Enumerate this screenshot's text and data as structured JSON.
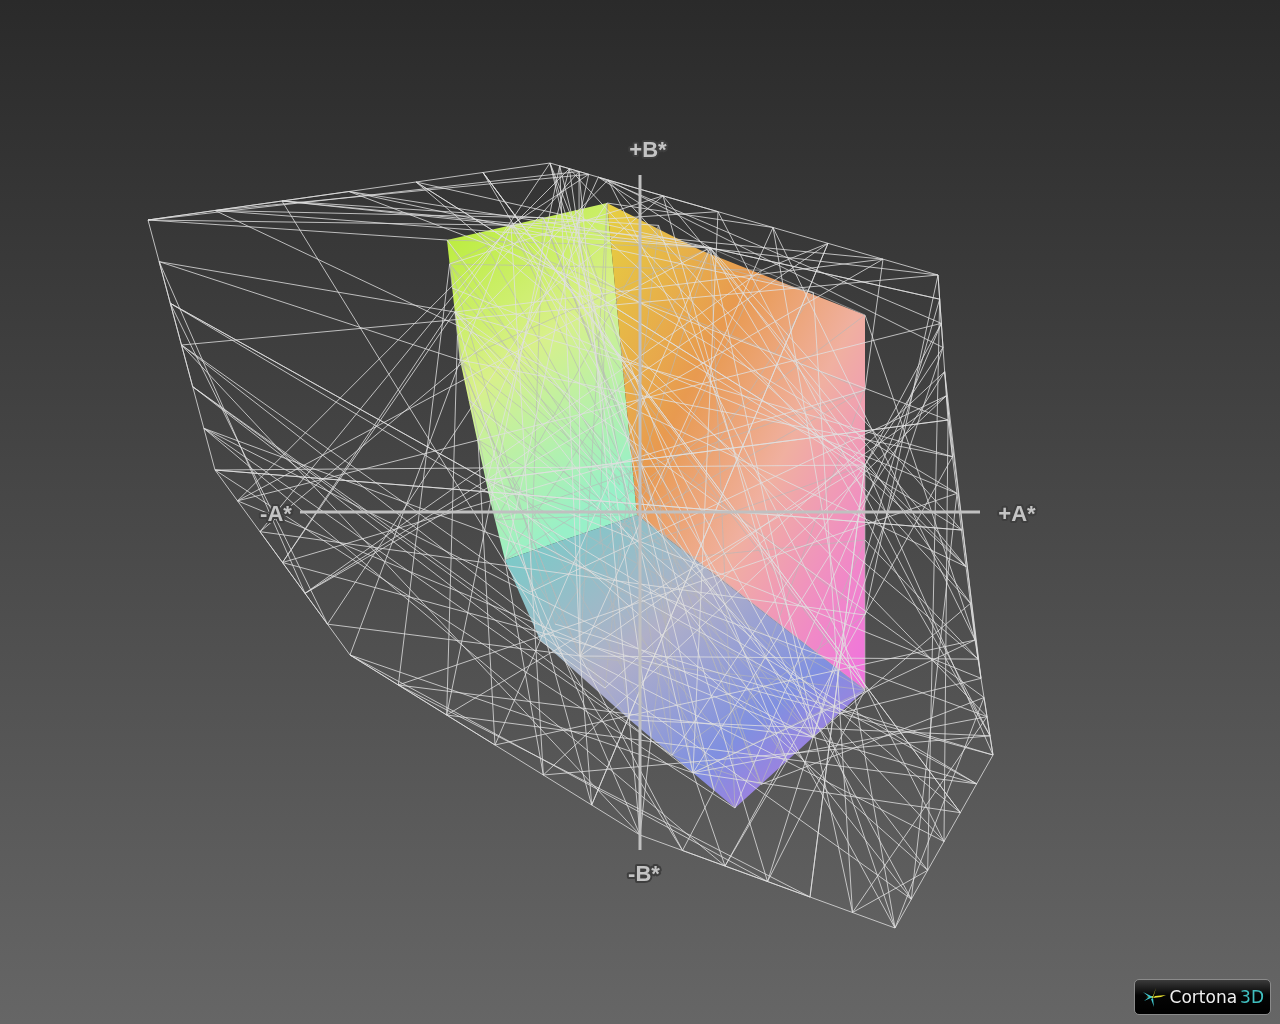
{
  "viewer": {
    "label_top": "+B*",
    "label_left": "-A*",
    "label_right": "+A*",
    "label_bottom": "-B*"
  },
  "badge": {
    "name": "Cortona",
    "suffix": "3D"
  }
}
